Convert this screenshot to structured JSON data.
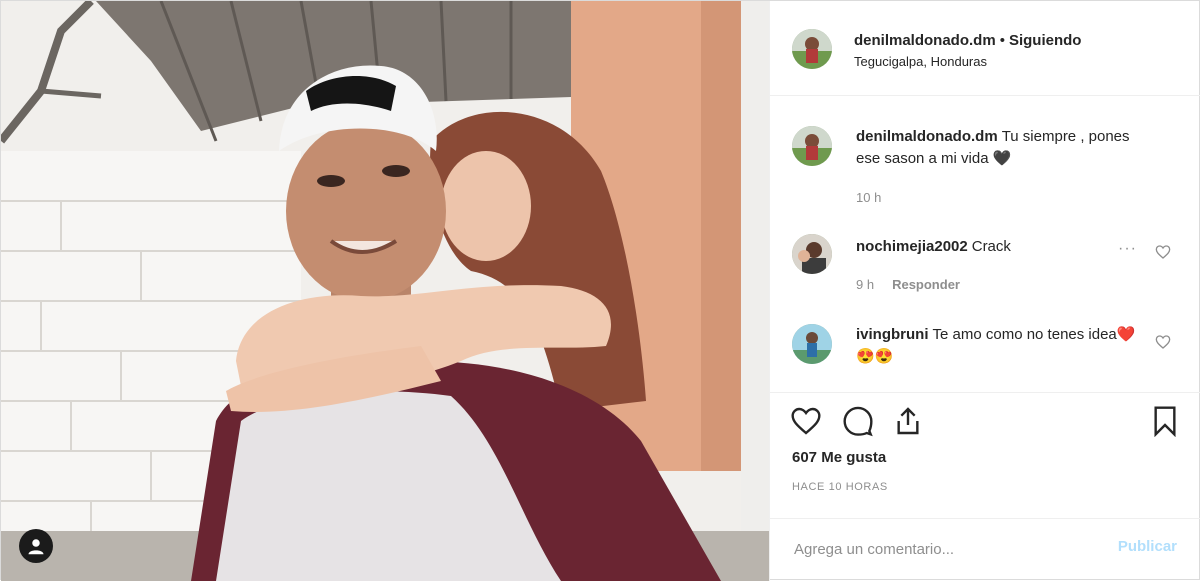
{
  "post": {
    "author": "denilmaldonado.dm",
    "separator": "•",
    "follow_status": "Siguiendo",
    "location": "Tegucigalpa, Honduras"
  },
  "caption": {
    "username": "denilmaldonado.dm",
    "text": "Tu siempre , pones ese sason a mi vida 🖤",
    "time": "10 h"
  },
  "comments": [
    {
      "username": "nochimejia2002",
      "text": "Crack",
      "time": "9 h",
      "reply_label": "Responder"
    },
    {
      "username": "ivingbruni",
      "text": "Te amo como no tenes idea❤️😍😍"
    }
  ],
  "action_icons": [
    "heart-icon",
    "comment-icon",
    "share-icon",
    "bookmark-icon"
  ],
  "likes": "607 Me gusta",
  "timestamp": "HACE 10 HORAS",
  "add_comment": {
    "placeholder": "Agrega un comentario...",
    "publish_label": "Publicar"
  },
  "colors": {
    "text": "#262626",
    "muted": "#8e8e8e",
    "publish_disabled": "#b2dffc",
    "border": "#efefef"
  }
}
